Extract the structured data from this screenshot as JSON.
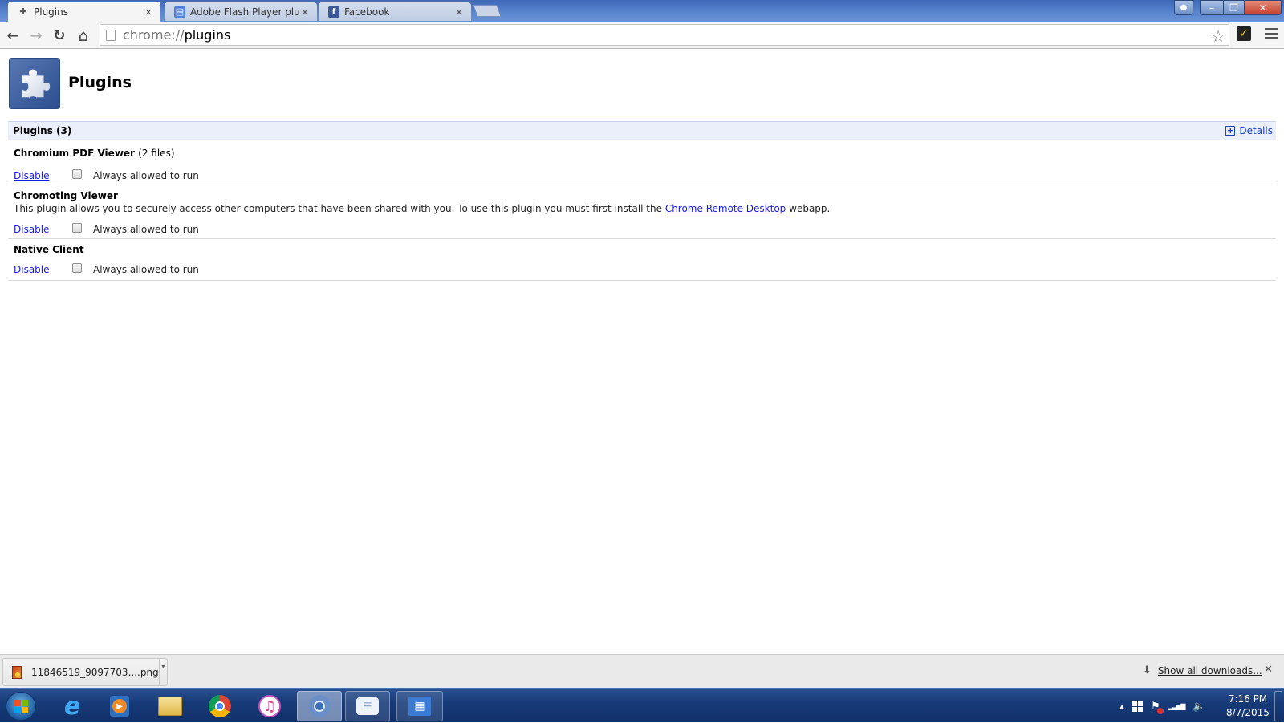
{
  "browser": {
    "tabs": [
      {
        "title": "Plugins",
        "icon": "puzzle-icon",
        "active": true
      },
      {
        "title": "Adobe Flash Player plugin",
        "icon": "google-sites-icon",
        "active": false
      },
      {
        "title": "Facebook",
        "icon": "facebook-icon",
        "active": false
      }
    ],
    "tab_close_glyph": "×",
    "window_controls": {
      "minimize": "–",
      "maximize": "❐",
      "close": "✕"
    },
    "toolbar": {
      "back": "←",
      "forward": "→",
      "reload": "↻",
      "home": "⌂",
      "url_scheme": "chrome://",
      "url_host": "plugins",
      "star": "☆",
      "norton": "✓"
    }
  },
  "page": {
    "title": "Plugins",
    "section": {
      "label": "Plugins (3)",
      "details_label": "Details",
      "details_glyph": "+"
    },
    "plugins": [
      {
        "name": "Chromium PDF Viewer",
        "files": "(2 files)",
        "description": "",
        "link_text": "",
        "description_suffix": "",
        "disable_label": "Disable",
        "always_allowed_label": "Always allowed to run",
        "always_allowed_checked": false
      },
      {
        "name": "Chromoting Viewer",
        "files": "",
        "description": "This plugin allows you to securely access other computers that have been shared with you. To use this plugin you must first install the ",
        "link_text": "Chrome Remote Desktop",
        "description_suffix": " webapp.",
        "disable_label": "Disable",
        "always_allowed_label": "Always allowed to run",
        "always_allowed_checked": false
      },
      {
        "name": "Native Client",
        "files": "",
        "description": "",
        "link_text": "",
        "description_suffix": "",
        "disable_label": "Disable",
        "always_allowed_label": "Always allowed to run",
        "always_allowed_checked": false
      }
    ]
  },
  "download_shelf": {
    "item_filename": "11846519_9097703....png",
    "dropdown_glyph": "▾",
    "show_all_label": "Show all downloads...",
    "download_glyph": "⬇",
    "close_glyph": "✕"
  },
  "taskbar": {
    "apps": [
      {
        "name": "internet-explorer",
        "glyph": "e",
        "running": false
      },
      {
        "name": "media-player",
        "glyph": "▶",
        "running": false
      },
      {
        "name": "file-explorer",
        "glyph": "▭",
        "running": false
      },
      {
        "name": "chrome",
        "glyph": "◉",
        "running": false
      },
      {
        "name": "itunes",
        "glyph": "♫",
        "running": false
      },
      {
        "name": "chromium",
        "glyph": "◎",
        "running": true
      },
      {
        "name": "messaging",
        "glyph": "☰",
        "running": true
      },
      {
        "name": "remote-desktop",
        "glyph": "▦",
        "running": true
      }
    ],
    "tray": {
      "overflow": "▲",
      "signal": "▂▃▅▇",
      "volume": "🔈"
    },
    "clock": {
      "time": "7:16 PM",
      "date": "8/7/2015"
    }
  }
}
